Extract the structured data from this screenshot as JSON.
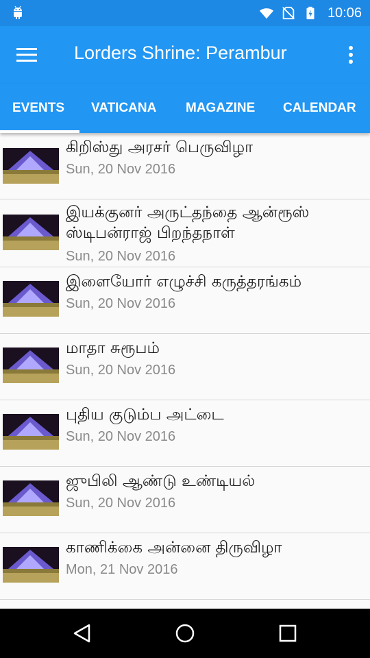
{
  "status_bar": {
    "time": "10:06",
    "icons": [
      "android-icon",
      "wifi-icon",
      "no-sim-icon",
      "battery-charging-icon"
    ]
  },
  "app_bar": {
    "title": "Lorders Shrine: Perambur",
    "menu_icon": "hamburger-menu-icon",
    "overflow_icon": "more-vert-icon"
  },
  "colors": {
    "status_bar": "#1e88e5",
    "primary": "#2196f3",
    "text_primary": "#212121",
    "text_secondary": "#8a8a8a"
  },
  "tabs": [
    {
      "label": "EVENTS",
      "selected": true
    },
    {
      "label": "VATICANA",
      "selected": false
    },
    {
      "label": "MAGAZINE",
      "selected": false
    },
    {
      "label": "CALENDAR",
      "selected": false
    }
  ],
  "events": [
    {
      "title": "கிறிஸ்து அரசர் பெருவிழா",
      "date": "Sun, 20 Nov 2016"
    },
    {
      "title": "இயக்குனர் அருட்தந்தை ஆன்ரூஸ் ஸ்டிபன்ராஜ் பிறந்தநாள்",
      "date": "Sun, 20 Nov 2016"
    },
    {
      "title": "இளையோர் எழுச்சி கருத்தரங்கம்",
      "date": "Sun, 20 Nov 2016"
    },
    {
      "title": "மாதா சுரூபம்",
      "date": "Sun, 20 Nov 2016"
    },
    {
      "title": "புதிய குடும்ப அட்டை",
      "date": "Sun, 20 Nov 2016"
    },
    {
      "title": "ஜுபிலி ஆண்டு உண்டியல்",
      "date": "Sun, 20 Nov 2016"
    },
    {
      "title": "காணிக்கை அன்னை திருவிழா",
      "date": "Mon, 21 Nov 2016"
    }
  ],
  "nav_bar": {
    "icons": [
      "back-icon",
      "home-icon",
      "recents-icon"
    ]
  }
}
